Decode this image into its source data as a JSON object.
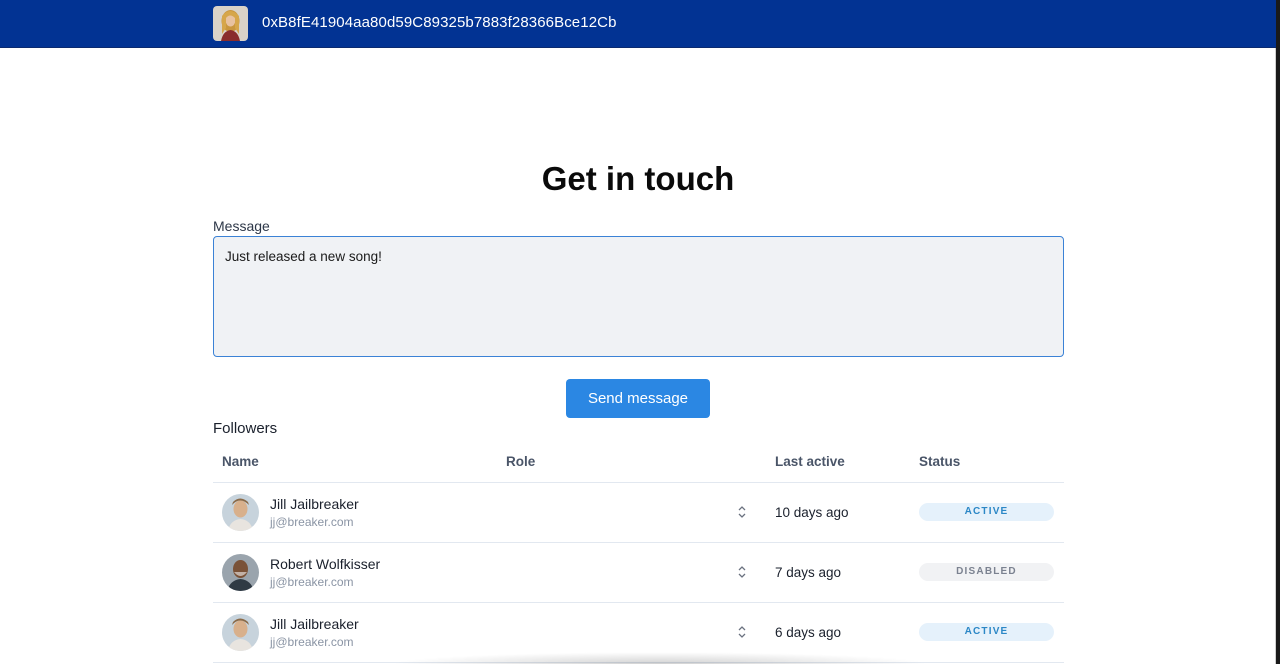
{
  "header": {
    "wallet_address": "0xB8fE41904aa80d59C89325b7883f28366Bce12Cb",
    "avatar_icon": "user-avatar-icon",
    "bg_color": "#023393"
  },
  "contact": {
    "title": "Get in touch",
    "message_label": "Message",
    "message_value": "Just released a new song!",
    "send_label": "Send message"
  },
  "followers": {
    "label": "Followers",
    "columns": [
      "Name",
      "Role",
      "Last active",
      "Status"
    ],
    "rows": [
      {
        "name": "Jill Jailbreaker",
        "email": "jj@breaker.com",
        "last_active": "10 days ago",
        "status": "ACTIVE"
      },
      {
        "name": "Robert Wolfkisser",
        "email": "jj@breaker.com",
        "last_active": "7 days ago",
        "status": "DISABLED"
      },
      {
        "name": "Jill Jailbreaker",
        "email": "jj@breaker.com",
        "last_active": "6 days ago",
        "status": "ACTIVE"
      }
    ]
  },
  "colors": {
    "accent": "#2b87e3",
    "active_badge": "#e5f1fb",
    "disabled_badge": "#f1f2f4"
  }
}
